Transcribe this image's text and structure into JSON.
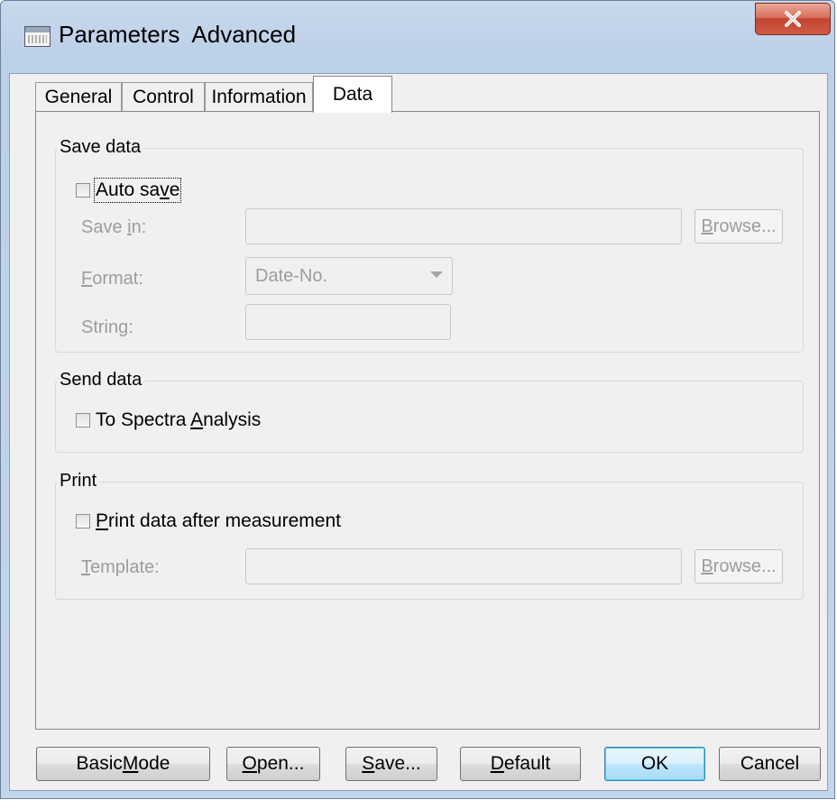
{
  "window": {
    "title": "Parameters  Advanced",
    "close_label": "x"
  },
  "tabs": [
    {
      "label": "General"
    },
    {
      "label": "Control"
    },
    {
      "label": "Information"
    },
    {
      "label": "Data",
      "active": true
    }
  ],
  "save_data": {
    "group_label": "Save data",
    "auto_save": {
      "pre": "Auto sa",
      "u": "v",
      "post": "e",
      "checked": false
    },
    "save_in": {
      "pre": "Save ",
      "u": "i",
      "post": "n:",
      "value": ""
    },
    "browse": {
      "u": "B",
      "post": "rowse..."
    },
    "format": {
      "pre": "",
      "u": "F",
      "post": "ormat:",
      "value": "Date-No."
    },
    "string": {
      "pre": "Strin",
      "u": "g",
      "post": ":",
      "value": ""
    }
  },
  "send_data": {
    "group_label": "Send data",
    "to_spectra": {
      "pre": "To Spectra ",
      "u": "A",
      "post": "nalysis",
      "checked": false
    }
  },
  "print": {
    "group_label": "Print",
    "print_after": {
      "pre": "",
      "u": "P",
      "post": "rint data after measurement",
      "checked": false
    },
    "template": {
      "pre": "",
      "u": "T",
      "post": "emplate:",
      "value": ""
    },
    "browse": {
      "u": "B",
      "post": "rowse..."
    }
  },
  "buttons": {
    "basic_mode": {
      "pre": "Basic ",
      "u": "M",
      "post": "ode"
    },
    "open": {
      "pre": "",
      "u": "O",
      "post": "pen..."
    },
    "save": {
      "pre": "",
      "u": "S",
      "post": "ave..."
    },
    "default": {
      "pre": "",
      "u": "D",
      "post": "efault"
    },
    "ok": "OK",
    "cancel": "Cancel"
  }
}
